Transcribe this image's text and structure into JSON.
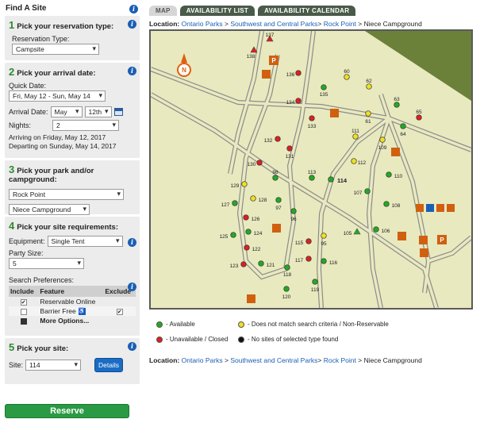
{
  "panel": {
    "title": "Find A Site"
  },
  "step1": {
    "num": "1",
    "title": "Pick your reservation type:",
    "type_label": "Reservation Type:",
    "type_value": "Campsite"
  },
  "step2": {
    "num": "2",
    "title": "Pick your arrival date:",
    "quick_label": "Quick Date:",
    "quick_value": "Fri, May 12 - Sun, May 14",
    "arrival_label": "Arrival Date:",
    "arrival_month": "May",
    "arrival_day": "12th",
    "nights_label": "Nights:",
    "nights_value": "2",
    "arriving": "Arriving on Friday, May 12, 2017",
    "departing": "Departing on Sunday, May 14, 2017"
  },
  "step3": {
    "num": "3",
    "title": "Pick your park and/or campground:",
    "park_value": "Rock Point",
    "campground_value": "Niece Campground"
  },
  "step4": {
    "num": "4",
    "title": "Pick your site requirements:",
    "equipment_label": "Equipment:",
    "equipment_value": "Single Tent",
    "party_label": "Party Size:",
    "party_value": "5",
    "prefs_label": "Search Preferences:",
    "col_include": "Include",
    "col_feature": "Feature",
    "col_exclude": "Exclude",
    "rows": [
      {
        "include": "✔",
        "feature": "Reservable Online",
        "exclude": ""
      },
      {
        "include": "",
        "feature": "Barrier Free",
        "exclude": "✔"
      }
    ],
    "more_options": "More Options..."
  },
  "step5": {
    "num": "5",
    "title": "Pick your site:",
    "site_label": "Site:",
    "site_value": "114",
    "details_label": "Details"
  },
  "reserve_label": "Reserve",
  "tabs": [
    {
      "label": "MAP",
      "active": true
    },
    {
      "label": "AVAILABILITY LIST",
      "active": false
    },
    {
      "label": "AVAILABILITY CALENDAR",
      "active": false
    }
  ],
  "breadcrumb": {
    "label": "Location:",
    "park_system": "Ontario Parks",
    "region": "Southwest and Central Parks",
    "park": "Rock Point",
    "campground": "Niece Campground",
    "sep": ">"
  },
  "legend": {
    "available": "- Available",
    "nomatch": "- Does not match search criteria / Non-Reservable",
    "unavailable": "- Unavailable / Closed",
    "none": "- No sites of selected type found"
  },
  "colors": {
    "available": "#22aa22",
    "nomatch": "#f0e020",
    "unavailable": "#dd2020",
    "none": "#111111",
    "accent": "#1a5fb4",
    "reserve": "#2a9a44"
  },
  "compass_label": "N",
  "selected_site": "114",
  "sites": [
    {
      "id": "137",
      "status": "triangle-red"
    },
    {
      "id": "138",
      "status": "triangle-red"
    },
    {
      "id": "136",
      "status": "unavailable"
    },
    {
      "id": "60",
      "status": "nomatch"
    },
    {
      "id": "62",
      "status": "nomatch"
    },
    {
      "id": "135",
      "status": "available"
    },
    {
      "id": "134",
      "status": "unavailable"
    },
    {
      "id": "63",
      "status": "available"
    },
    {
      "id": "65",
      "status": "unavailable"
    },
    {
      "id": "133",
      "status": "unavailable"
    },
    {
      "id": "61",
      "status": "nomatch"
    },
    {
      "id": "64",
      "status": "available"
    },
    {
      "id": "111",
      "status": "nomatch"
    },
    {
      "id": "109",
      "status": "nomatch"
    },
    {
      "id": "132",
      "status": "unavailable"
    },
    {
      "id": "131",
      "status": "unavailable"
    },
    {
      "id": "130",
      "status": "unavailable"
    },
    {
      "id": "112",
      "status": "nomatch"
    },
    {
      "id": "98",
      "status": "available"
    },
    {
      "id": "113",
      "status": "available"
    },
    {
      "id": "114",
      "status": "available"
    },
    {
      "id": "110",
      "status": "available"
    },
    {
      "id": "129",
      "status": "nomatch"
    },
    {
      "id": "128",
      "status": "nomatch"
    },
    {
      "id": "107",
      "status": "available"
    },
    {
      "id": "127",
      "status": "available"
    },
    {
      "id": "97",
      "status": "available"
    },
    {
      "id": "108",
      "status": "available"
    },
    {
      "id": "126",
      "status": "unavailable"
    },
    {
      "id": "96",
      "status": "available"
    },
    {
      "id": "125",
      "status": "available"
    },
    {
      "id": "124",
      "status": "available"
    },
    {
      "id": "105",
      "status": "triangle-green"
    },
    {
      "id": "106",
      "status": "available"
    },
    {
      "id": "115",
      "status": "unavailable"
    },
    {
      "id": "95",
      "status": "nomatch"
    },
    {
      "id": "122",
      "status": "unavailable"
    },
    {
      "id": "117",
      "status": "unavailable"
    },
    {
      "id": "116",
      "status": "available"
    },
    {
      "id": "123",
      "status": "unavailable"
    },
    {
      "id": "121",
      "status": "available"
    },
    {
      "id": "118",
      "status": "available"
    },
    {
      "id": "119",
      "status": "available"
    },
    {
      "id": "120",
      "status": "available"
    }
  ]
}
